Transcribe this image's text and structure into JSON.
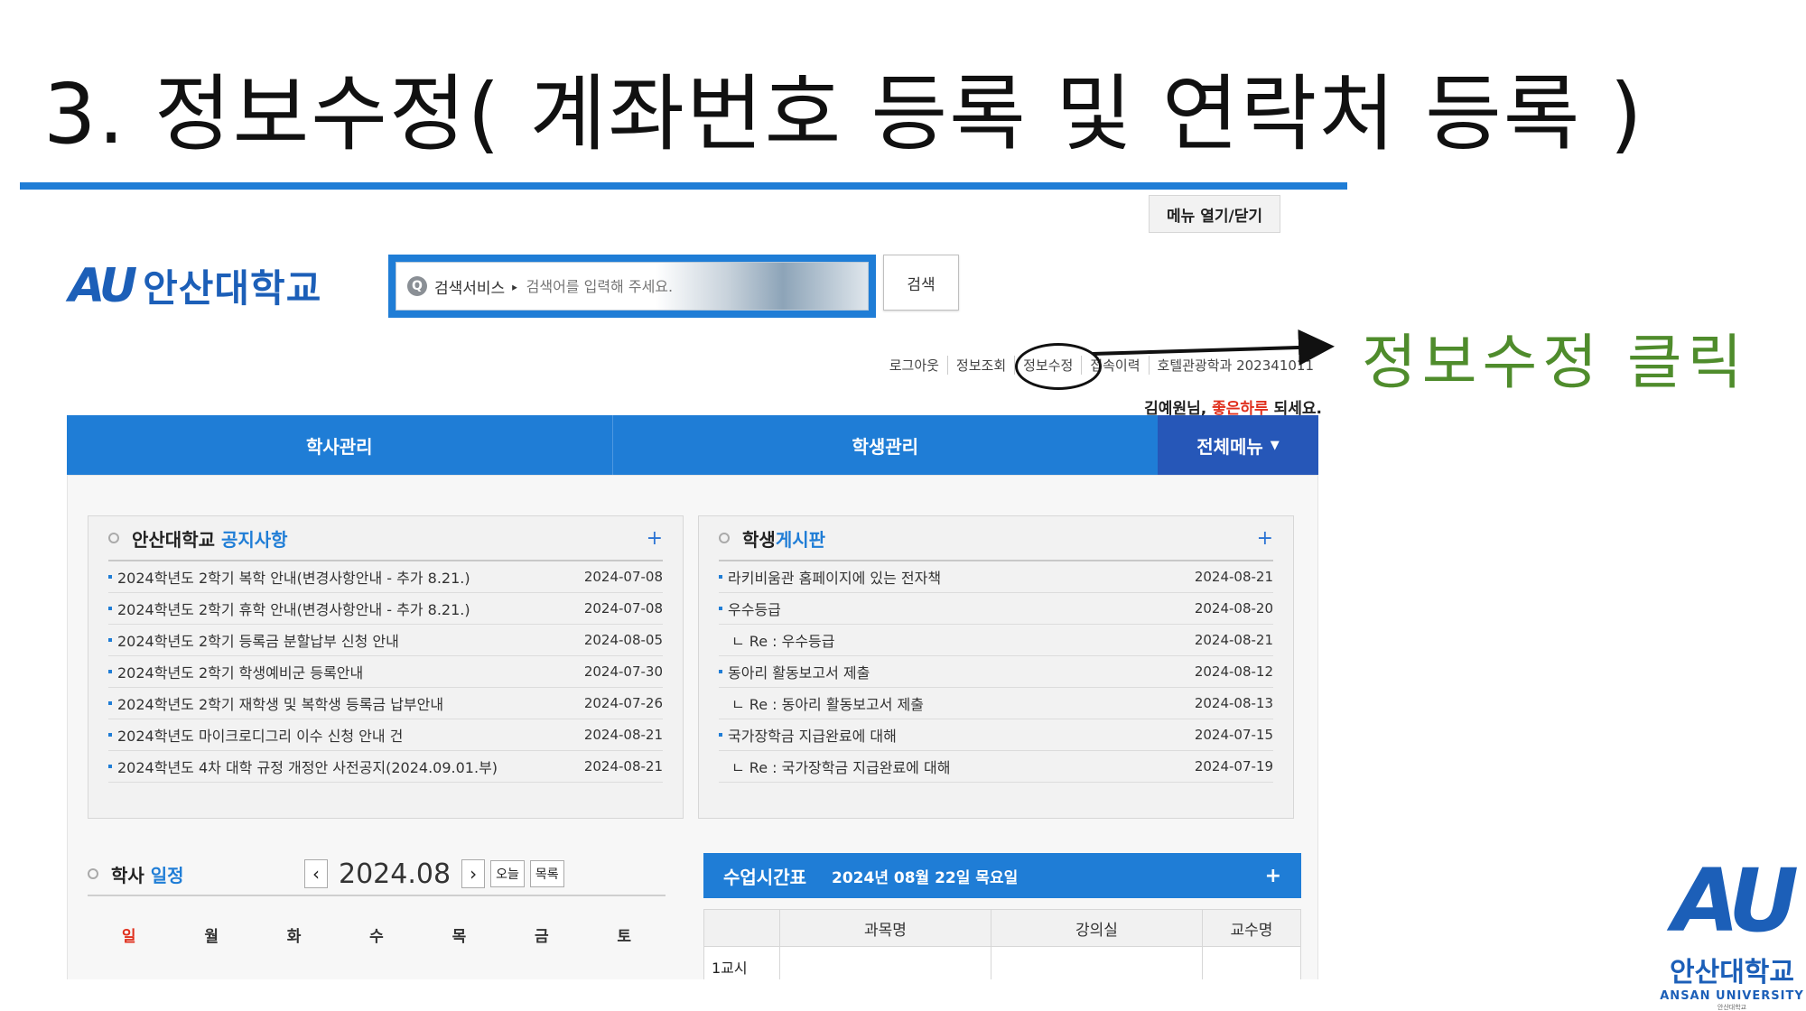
{
  "slide": {
    "title": "3. 정보수정( 계좌번호 등록 및 연락처 등록 )",
    "callout": "정보수정 클릭"
  },
  "header": {
    "menu_toggle": "메뉴 열기/닫기",
    "logo_mark": "AU",
    "logo_text": "안산대학교",
    "search_service": "검색서비스 ‣",
    "search_placeholder": "검색어를 입력해 주세요.",
    "search_button": "검색",
    "user_links": [
      "로그아웃",
      "정보조회",
      "정보수정",
      "접속이력",
      "호텔관광학과 202341011"
    ],
    "greeting_name": "김예원님,",
    "greeting_highlight": "좋은하루",
    "greeting_tail": "되세요."
  },
  "nav": {
    "items": [
      "학사관리",
      "학생관리"
    ],
    "all_menu": "전체메뉴",
    "all_menu_icon": "▼"
  },
  "notice_board": {
    "title_prefix": "안산대학교",
    "title_accent": "공지사항",
    "more": "+",
    "rows": [
      {
        "title": "2024학년도 2학기 복학 안내(변경사항안내 - 추가 8.21.)",
        "date": "2024-07-08"
      },
      {
        "title": "2024학년도 2학기 휴학 안내(변경사항안내 - 추가 8.21.)",
        "date": "2024-07-08"
      },
      {
        "title": "2024학년도 2학기 등록금 분할납부 신청 안내",
        "date": "2024-08-05"
      },
      {
        "title": "2024학년도 2학기 학생예비군 등록안내",
        "date": "2024-07-30"
      },
      {
        "title": "2024학년도 2학기 재학생 및 복학생 등록금 납부안내",
        "date": "2024-07-26"
      },
      {
        "title": "2024학년도 마이크로디그리 이수 신청 안내 건",
        "date": "2024-08-21"
      },
      {
        "title": "2024학년도 4차 대학 규정 개정안 사전공지(2024.09.01.부)",
        "date": "2024-08-21"
      }
    ]
  },
  "student_board": {
    "title_prefix": "학생",
    "title_accent": "게시판",
    "more": "+",
    "rows": [
      {
        "title": "라키비움관 홈페이지에 있는 전자책",
        "date": "2024-08-21",
        "reply": false
      },
      {
        "title": "우수등급",
        "date": "2024-08-20",
        "reply": false
      },
      {
        "title": "ㄴ Re : 우수등급",
        "date": "2024-08-21",
        "reply": true
      },
      {
        "title": "동아리 활동보고서 제출",
        "date": "2024-08-12",
        "reply": false
      },
      {
        "title": "ㄴ Re : 동아리 활동보고서 제출",
        "date": "2024-08-13",
        "reply": true
      },
      {
        "title": "국가장학금 지급완료에 대해",
        "date": "2024-07-15",
        "reply": false
      },
      {
        "title": "ㄴ Re : 국가장학금 지급완료에 대해",
        "date": "2024-07-19",
        "reply": true
      }
    ]
  },
  "calendar": {
    "title_prefix": "학사",
    "title_accent": "일정",
    "prev": "‹",
    "next": "›",
    "month": "2024.08",
    "today_btn": "오늘",
    "list_btn": "목록",
    "weekdays": [
      "일",
      "월",
      "화",
      "수",
      "목",
      "금",
      "토"
    ]
  },
  "timetable": {
    "title": "수업시간표",
    "date": "2024년 08월 22일 목요일",
    "more": "+",
    "columns": [
      "",
      "과목명",
      "강의실",
      "교수명"
    ],
    "first_row_label": "1교시"
  },
  "corner_logo": {
    "mark": "AU",
    "name": "안산대학교",
    "eng": "ANSAN UNIVERSITY",
    "tiny": "안산대학교"
  },
  "colors": {
    "accent_blue": "#1f7dd6",
    "nav_dark_blue": "#2657b8",
    "callout_green": "#4f8c2c",
    "greeting_red": "#e0301e"
  }
}
